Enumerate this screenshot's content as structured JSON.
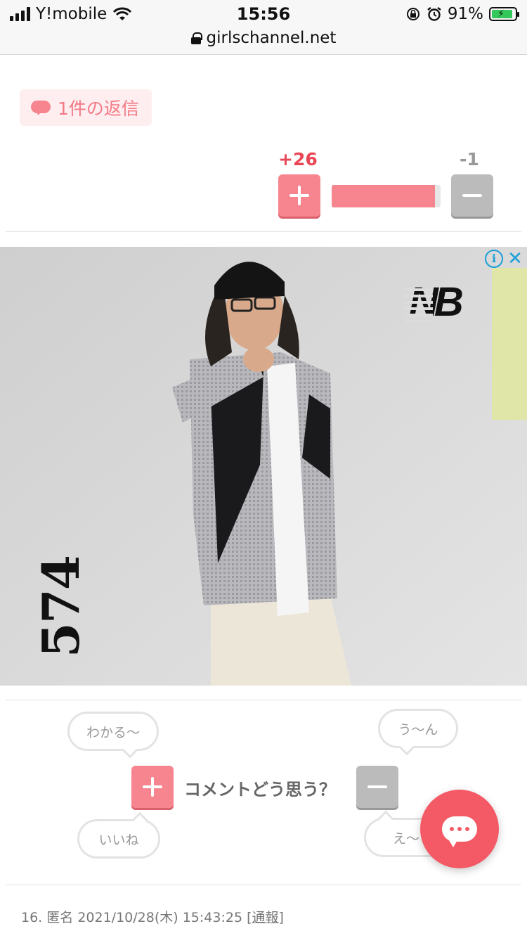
{
  "status_bar": {
    "carrier": "Y!mobile",
    "time": "15:56",
    "battery_percent": "91%",
    "battery_level": 0.91
  },
  "url_bar": {
    "url": "girlschannel.net"
  },
  "comment": {
    "reply_label": "1件の返信",
    "plus_count": "+26",
    "minus_count": "-1",
    "ratio": 0.95
  },
  "ad": {
    "brand": "NB",
    "model": "574",
    "info_label": "i",
    "close_label": "✕"
  },
  "reactions": {
    "top_left": "わかる〜",
    "top_right": "う〜ん",
    "bottom_left": "いいね",
    "bottom_right": "え〜",
    "prompt": "コメントどう思う？"
  },
  "next_comment": {
    "number": "16.",
    "author": "匿名",
    "datetime": "2021/10/28(木) 15:43:25",
    "report_label": "通報"
  },
  "colors": {
    "accent_pink": "#f7858f",
    "plus_red": "#ea4554",
    "fab_red": "#f45a66"
  }
}
